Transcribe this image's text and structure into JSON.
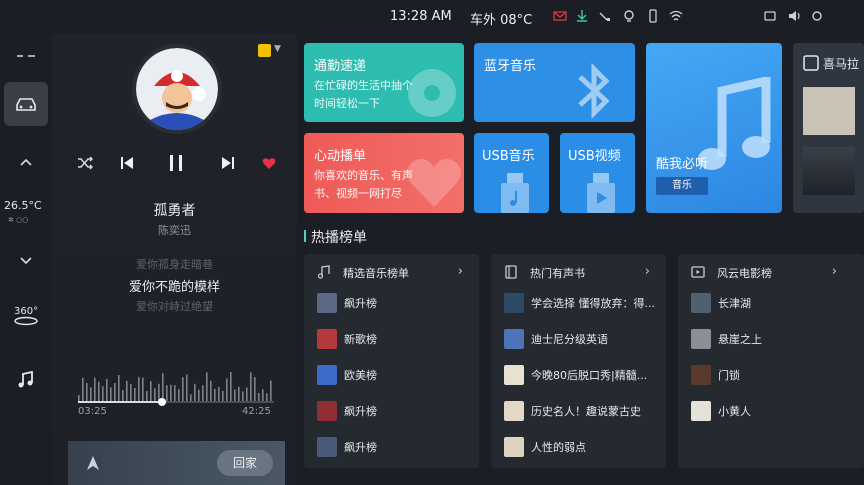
{
  "status": {
    "time": "13:28 AM",
    "outside_temp": "车外 08°C",
    "icons": [
      "mail-icon",
      "download-icon",
      "signal-icon",
      "location-icon",
      "phone-icon",
      "wifi-icon",
      "bluetooth-icon",
      "volume-icon",
      "settings-icon"
    ]
  },
  "sidebar": {
    "cabin_temp": "26.5°C",
    "cabin_sub": "✲ ○○",
    "view_label": "360°"
  },
  "player": {
    "title": "孤勇者",
    "artist": "陈奕迅",
    "lyrics": {
      "prev": "爱你孤身走暗巷",
      "current": "爱你不跪的模样",
      "next": "爱你对峙过绝望"
    },
    "elapsed": "03:25",
    "total": "42:25",
    "progress": 0.43,
    "home_button": "回家",
    "accent": "#e0334a"
  },
  "tiles": {
    "commute": {
      "title": "通勤速递",
      "line1": "在忙碌的生活中抽个",
      "line2": "时间轻松一下",
      "color": "#2cbcb0"
    },
    "bluetooth": {
      "title": "蓝牙音乐",
      "color": "#2e8fe6"
    },
    "kuwo": {
      "title": "酷我必听",
      "tag": "音乐",
      "color": "#3b9df0"
    },
    "heartbeat": {
      "title": "心动播单",
      "line1": "你喜欢的音乐、有声",
      "line2": "书、视频一网打尽",
      "color": "#f05a58"
    },
    "usb_music": {
      "title": "USB音乐",
      "color": "#2b8ee6"
    },
    "usb_video": {
      "title": "USB视频",
      "color": "#2b8ee6"
    },
    "ximalaya": {
      "title": "喜马拉"
    }
  },
  "hot": {
    "title": "热播榜单",
    "columns": [
      {
        "title": "精选音乐榜单",
        "items": [
          "飙升榜",
          "新歌榜",
          "欧美榜",
          "飙升榜",
          "飙升榜"
        ]
      },
      {
        "title": "热门有声书",
        "items": [
          "学会选择 懂得放弃：得...",
          "迪士尼分级英语",
          "今晚80后脱口秀|精髓...",
          "历史名人！趣说蒙古史",
          "人性的弱点"
        ]
      },
      {
        "title": "风云电影榜",
        "items": [
          "长津湖",
          "悬崖之上",
          "门锁",
          "小黄人"
        ]
      }
    ]
  }
}
